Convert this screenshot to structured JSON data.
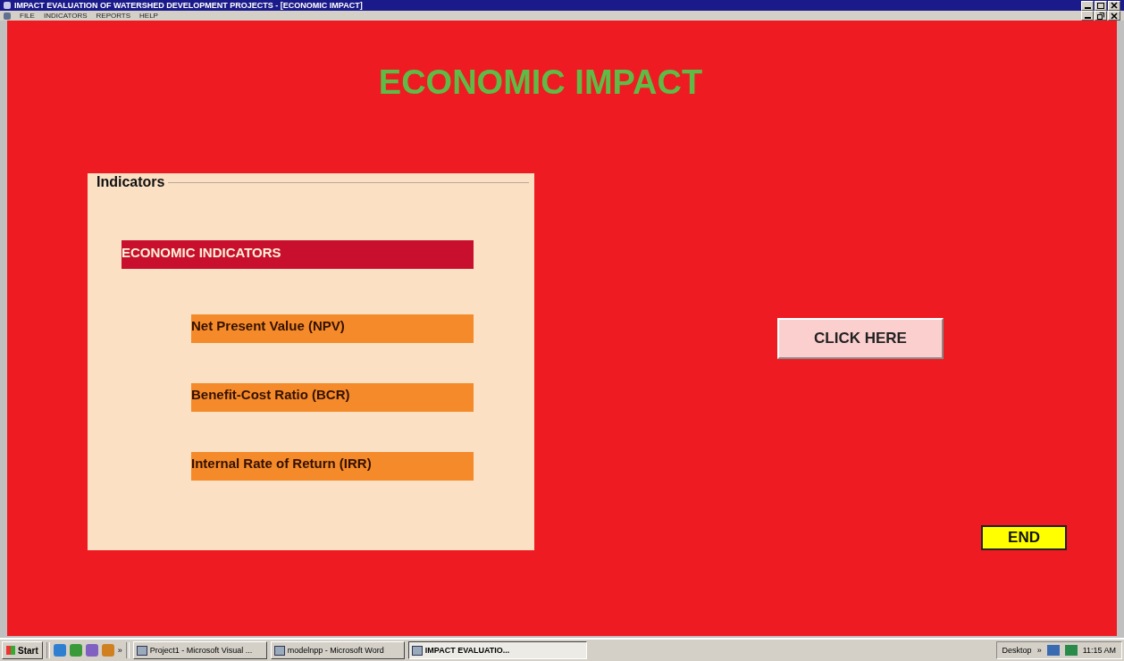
{
  "window": {
    "title": "IMPACT EVALUATION OF WATERSHED DEVELOPMENT PROJECTS - [ECONOMIC IMPACT]"
  },
  "menu": [
    "FILE",
    "INDICATORS",
    "REPORTS",
    "HELP"
  ],
  "heading": "ECONOMIC IMPACT",
  "indicators": {
    "legend": "Indicators",
    "group": "ECONOMIC INDICATORS",
    "items": [
      "Net Present Value (NPV)",
      "Benefit-Cost Ratio (BCR)",
      "Internal Rate of Return (IRR)"
    ]
  },
  "click_button": "CLICK HERE",
  "end_button": "END",
  "taskbar": {
    "start": "Start",
    "more": "»",
    "tasks": [
      {
        "label": "Project1 - Microsoft Visual ...",
        "selected": false
      },
      {
        "label": "modelnpp - Microsoft Word",
        "selected": false
      },
      {
        "label": "IMPACT EVALUATIO...",
        "selected": true
      }
    ],
    "toolbar": "Desktop",
    "more_tray": "»",
    "clock": "11:15 AM"
  }
}
